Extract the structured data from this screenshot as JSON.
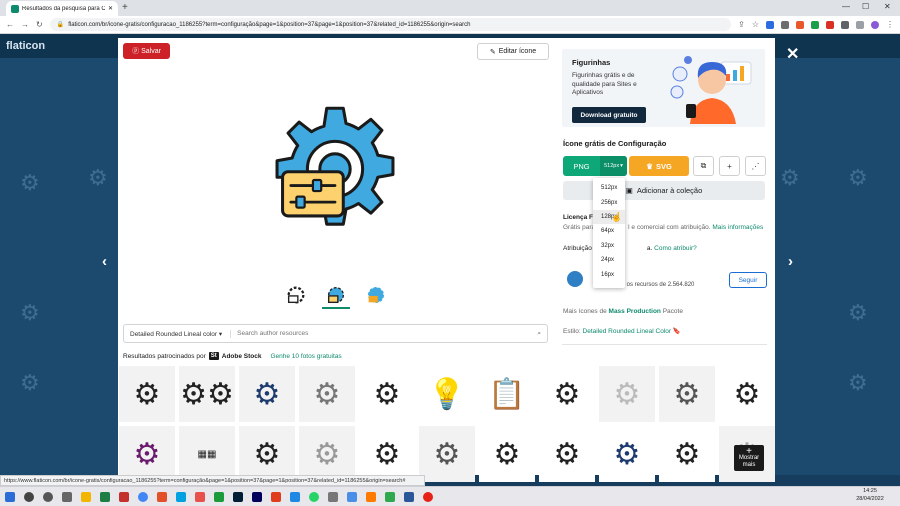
{
  "browser": {
    "tab_title": "Resultados da pesquisa para Co...",
    "new_tab": "+",
    "url": "flaticon.com/br/icone-gratis/configuracao_1186255?term=configuração&page=1&position=37&page=1&position=37&related_id=1186255&origin=search",
    "status_url": "https://www.flaticon.com/br/icone-gratis/configuracao_1186255?term=configuração&page=1&position=37&page=1&position=37&related_id=1186255&origin=search#"
  },
  "site": {
    "logo": "flaticon"
  },
  "modal": {
    "save_label": "Salvar",
    "edit_label": "Editar ícone",
    "search": {
      "style": "Detailed Rounded Lineal color",
      "placeholder": "Search author resources"
    },
    "sponsor": {
      "prefix": "Resultados patrocinados por",
      "brand": "Adobe Stock",
      "offer": "Genhe 10 fotos gratuitas"
    },
    "show_more": [
      "Mostrar",
      "mais"
    ]
  },
  "panel": {
    "promo": {
      "title": "Figurinhas",
      "text": "Figurinhas grátis e de qualidade para Sites e Aplicativos",
      "button": "Download gratuito"
    },
    "icon_title": "Ícone grátis de Configuração",
    "png_label": "PNG",
    "png_size": "512px",
    "svg_label": "SVG",
    "add_collection": "Adicionar à coleção",
    "license_title": "Licença Fl",
    "license_text_a": "Grátis para",
    "license_text_b": "l e comercial com atribuição",
    "license_more": "Mais informações",
    "attribution_a": "Atribuição",
    "attribution_b": "a.",
    "attribution_link": "Como atribuir?",
    "author_text": "odos os recursos de 2.564.820",
    "follow_label": "Seguir",
    "more_from_prefix": "Mais ícones de",
    "more_from_author": "Mass Production",
    "more_from_suffix": "Pacote",
    "style_prefix": "Estilo:",
    "style_name": "Detailed Rounded Lineal Color"
  },
  "dropdown": {
    "options": [
      "512px",
      "256px",
      "128px",
      "64px",
      "32px",
      "24px",
      "16px"
    ]
  },
  "taskbar": {
    "time": "14:25",
    "date": "28/04/2022"
  },
  "colors": {
    "accent_green": "#0ea878",
    "svg_orange": "#f5a623",
    "save_red": "#cc2127",
    "icon_blue": "#3fa9e0",
    "icon_yellow": "#fdd26e"
  }
}
